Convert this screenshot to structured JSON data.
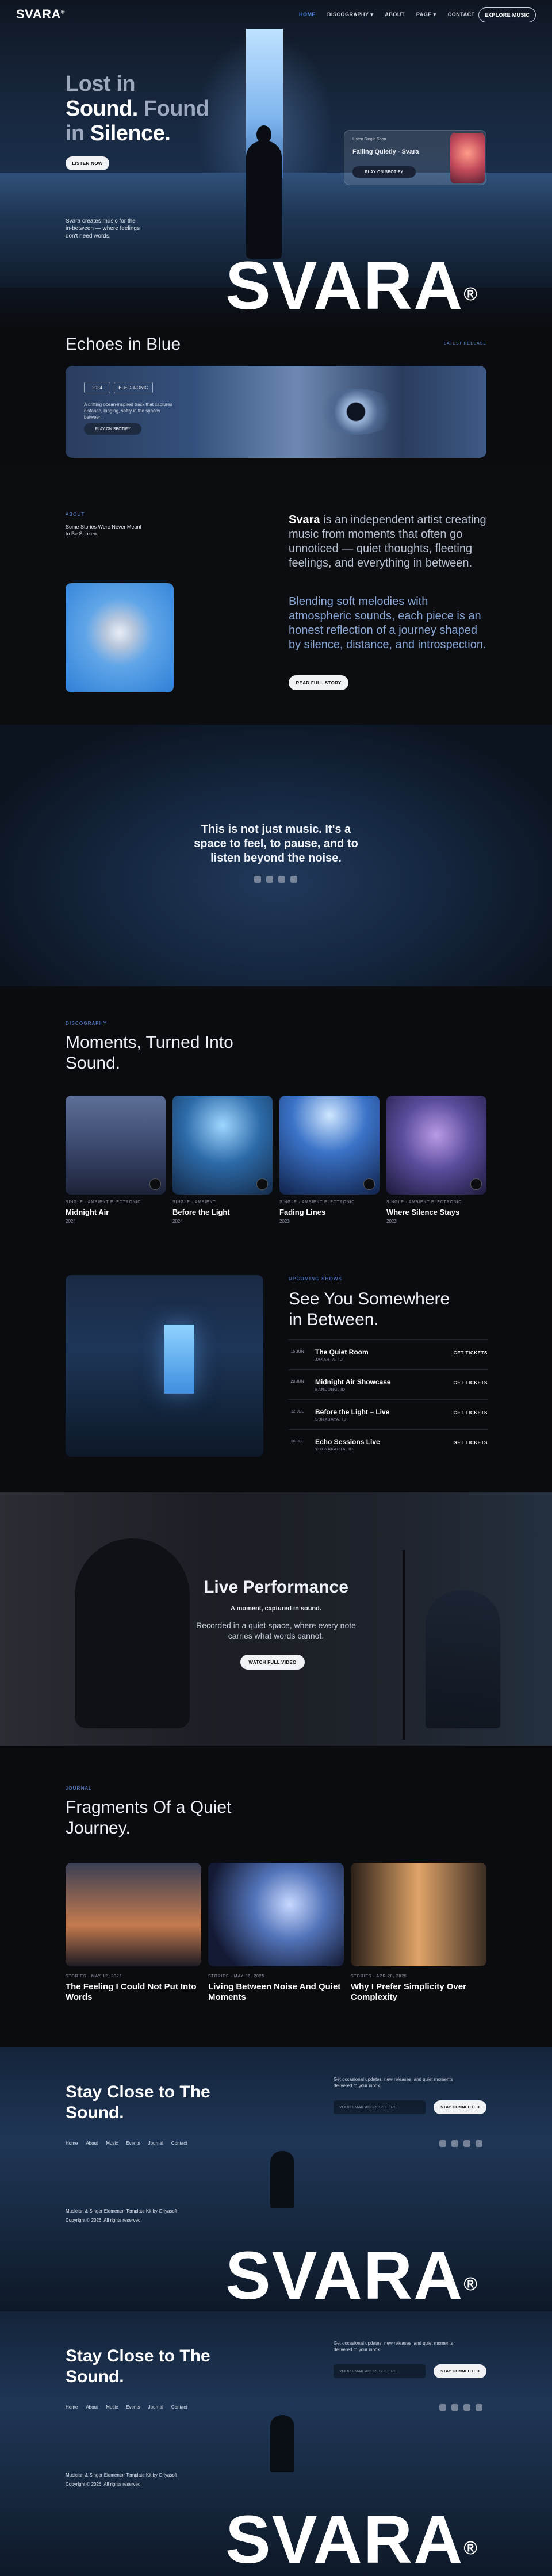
{
  "header": {
    "logo": "SVARA",
    "logo_mark": "®",
    "nav": [
      "HOME",
      "DISCOGRAPHY ▾",
      "ABOUT",
      "PAGE ▾",
      "CONTACT"
    ],
    "cta": "EXPLORE MUSIC"
  },
  "hero": {
    "title_line1": "Lost in",
    "title_line2_a": "Sound.",
    "title_line2_b": "Found",
    "title_line3_a": "in",
    "title_line3_b": "Silence.",
    "listen": "LISTEN NOW",
    "desc": "Svara creates music for the in-between — where feelings don't need words.",
    "now_playing_label": "Listen Single Soon",
    "now_playing_title": "Falling Quietly - Svara",
    "play_button": "PLAY ON SPOTIFY",
    "brand": "SVARA",
    "brand_mark": "®"
  },
  "echoes": {
    "title": "Echoes in Blue",
    "more": "LATEST RELEASE",
    "tag1": "2024",
    "tag2": "ELECTRONIC",
    "text": "A drifting ocean-inspired track that captures distance, longing, softly in the spaces between.",
    "play": "PLAY ON SPOTIFY"
  },
  "about": {
    "label": "ABOUT",
    "sub": "Some Stories Were Never Meant to Be Spoken.",
    "p1_name": "Svara",
    "p1_rest": " is an independent artist creating music from moments that often go unnoticed — quiet thoughts, fleeting feelings, and everything in between.",
    "p2": "Blending soft melodies with atmospheric sounds, each piece is an honest reflection of a journey shaped by silence, distance, and introspection.",
    "read": "READ FULL STORY"
  },
  "quote": {
    "text": "This is not just music. It's a space to feel, to pause, and to listen beyond the noise."
  },
  "discography": {
    "label": "DISCOGRAPHY",
    "title": "Moments, Turned Into Sound.",
    "albums": [
      {
        "genre": "SINGLE · AMBIENT ELECTRONIC",
        "name": "Midnight Air",
        "year": "2024"
      },
      {
        "genre": "SINGLE · AMBIENT",
        "name": "Before the Light",
        "year": "2024"
      },
      {
        "genre": "SINGLE · AMBIENT ELECTRONIC",
        "name": "Fading Lines",
        "year": "2023"
      },
      {
        "genre": "SINGLE · AMBIENT ELECTRONIC",
        "name": "Where Silence Stays",
        "year": "2023"
      }
    ]
  },
  "upcoming": {
    "label": "UPCOMING SHOWS",
    "title": "See You Somewhere in Between.",
    "events": [
      {
        "date": "15 JUN",
        "name": "The Quiet Room",
        "loc": "JAKARTA, ID",
        "tickets": "GET TICKETS"
      },
      {
        "date": "28 JUN",
        "name": "Midnight Air Showcase",
        "loc": "BANDUNG, ID",
        "tickets": "GET TICKETS"
      },
      {
        "date": "12 JUL",
        "name": "Before the Light – Live",
        "loc": "SURABAYA, ID",
        "tickets": "GET TICKETS"
      },
      {
        "date": "26 JUL",
        "name": "Echo Sessions Live",
        "loc": "YOGYAKARTA, ID",
        "tickets": "GET TICKETS"
      }
    ]
  },
  "live": {
    "title": "Live Performance",
    "sub1": "A moment, captured in sound.",
    "sub2": "Recorded in a quiet space, where every note carries what words cannot.",
    "watch": "WATCH FULL VIDEO"
  },
  "journal": {
    "label": "JOURNAL",
    "title": "Fragments Of a Quiet Journey.",
    "posts": [
      {
        "meta": "STORIES · MAY 12, 2025",
        "title": "The Feeling I Could Not Put Into Words"
      },
      {
        "meta": "STORIES · MAY 06, 2025",
        "title": "Living Between Noise And Quiet Moments"
      },
      {
        "meta": "STORIES · APR 28, 2025",
        "title": "Why I Prefer Simplicity Over Complexity"
      }
    ]
  },
  "footer": {
    "title": "Stay Close to The Sound.",
    "stay_text": "Get occasional updates, new releases, and quiet moments delivered to your inbox.",
    "email_placeholder": "YOUR EMAIL ADDRESS HERE",
    "subscribe": "STAY CONNECTED",
    "links": [
      "Home",
      "About",
      "Music",
      "Events",
      "Journal",
      "Contact"
    ],
    "credit": "Musician & Singer Elementor Template Kit by Griyasoft",
    "copyright": "Copyright © 2026. All rights reserved.",
    "brand": "SVARA",
    "brand_mark": "®"
  }
}
